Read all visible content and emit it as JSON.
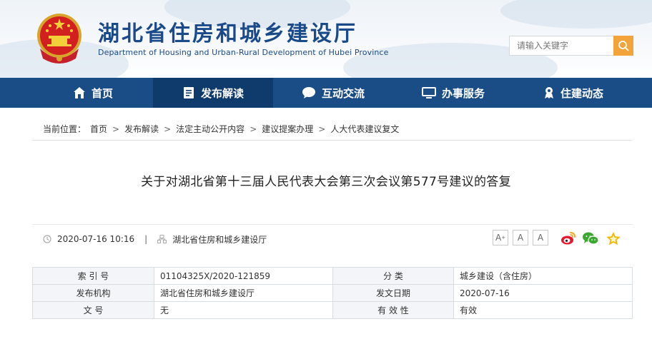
{
  "header": {
    "title": "湖北省住房和城乡建设厅",
    "subtitle": "Department of Housing and Urban-Rural Development of Hubei Province",
    "emblem_icon": "national-emblem-icon"
  },
  "search": {
    "placeholder": "请输入关键字"
  },
  "nav": {
    "items": [
      {
        "label": "首页",
        "icon": "home-icon"
      },
      {
        "label": "发布解读",
        "icon": "document-icon"
      },
      {
        "label": "互动交流",
        "icon": "chat-bubble-icon"
      },
      {
        "label": "办事服务",
        "icon": "monitor-icon"
      },
      {
        "label": "住建动态",
        "icon": "award-icon"
      }
    ],
    "active_index": 1
  },
  "breadcrumb": {
    "prefix": "当前位置：",
    "items": [
      "首页",
      "发布解读",
      "法定主动公开内容",
      "建议提案办理",
      "人大代表建议复文"
    ],
    "separator": ">"
  },
  "article": {
    "title": "关于对湖北省第十三届人民代表大会第三次会议第577号建议的答复",
    "datetime": "2020-07-16 10:16",
    "source": "湖北省住房和城乡建设厅",
    "separator": "|"
  },
  "font_controls": [
    "A",
    "A",
    "A"
  ],
  "share_icons": [
    "weibo-icon",
    "wechat-icon",
    "favorite-star-icon"
  ],
  "info_table": {
    "rows": [
      {
        "label1": "索 引 号",
        "value1": "01104325X/2020-121859",
        "label2": "分 类",
        "value2": "城乡建设（含住房）"
      },
      {
        "label1": "发布机构",
        "value1": "湖北省住房和城乡建设厅",
        "label2": "发文日期",
        "value2": "2020-07-16"
      },
      {
        "label1": "文 号",
        "value1": "无",
        "label2": "有 效 性",
        "value2": "有效"
      }
    ]
  },
  "colors": {
    "nav_bg": "#1a4c85",
    "nav_active_bg": "#0f3a6c",
    "title_blue": "#1a4a8a",
    "search_button": "#f2a33a",
    "weibo_red": "#e6162d",
    "wechat_green": "#3ba830",
    "star_yellow": "#f5b800"
  }
}
